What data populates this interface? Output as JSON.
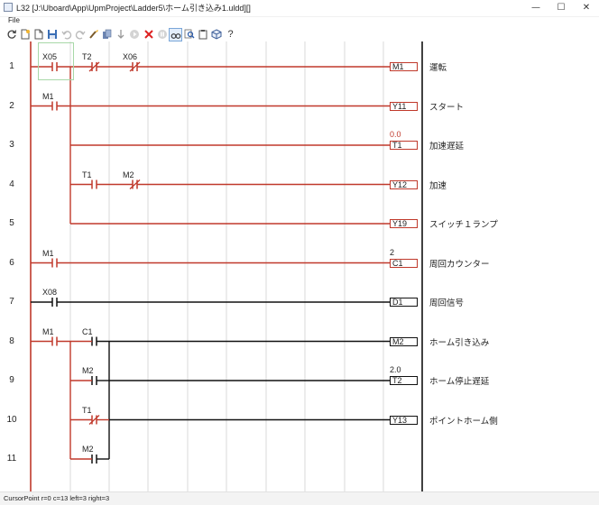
{
  "window": {
    "title": "L32 [J:\\Uboard\\App\\UpmProject\\Ladder5\\ホーム引き込み1.uldd][]",
    "minimize_glyph": "—",
    "maximize_glyph": "☐",
    "close_glyph": "✕"
  },
  "menu": {
    "file": "File"
  },
  "toolbar": {
    "icons": [
      "refresh-icon",
      "new-file-icon",
      "open-file-icon",
      "save-icon",
      "undo-icon",
      "redo-icon",
      "edit-brush-icon",
      "copy-icon",
      "down-arrow-icon",
      "play-icon",
      "stop-icon",
      "pause-icon",
      "glasses-icon",
      "search-icon",
      "clipboard-icon",
      "cube-icon",
      "help-icon"
    ],
    "help_label": "?"
  },
  "ladder": {
    "rows": [
      {
        "num": "1",
        "coil": "M1",
        "coil_value": "",
        "comment": "運転",
        "energized": true
      },
      {
        "num": "2",
        "coil": "Y11",
        "coil_value": "",
        "comment": "スタート",
        "energized": true
      },
      {
        "num": "3",
        "coil": "T1",
        "coil_value": "0.0",
        "comment": "加速遅延",
        "energized": true
      },
      {
        "num": "4",
        "coil": "Y12",
        "coil_value": "",
        "comment": "加速",
        "energized": true
      },
      {
        "num": "5",
        "coil": "Y19",
        "coil_value": "",
        "comment": "スイッチ１ランプ",
        "energized": true
      },
      {
        "num": "6",
        "coil": "C1",
        "coil_value": "2",
        "comment": "周回カウンター",
        "energized": true
      },
      {
        "num": "7",
        "coil": "D1",
        "coil_value": "",
        "comment": "周回信号",
        "energized": false
      },
      {
        "num": "8",
        "coil": "M2",
        "coil_value": "",
        "comment": "ホーム引き込み",
        "energized": false
      },
      {
        "num": "9",
        "coil": "T2",
        "coil_value": "2.0",
        "comment": "ホーム停止遅延",
        "energized": false
      },
      {
        "num": "10",
        "coil": "Y13",
        "coil_value": "",
        "comment": "ポイントホーム側",
        "energized": false
      },
      {
        "num": "11",
        "coil": "",
        "coil_value": "",
        "comment": "",
        "energized": false
      }
    ],
    "contacts": [
      {
        "label": "X05",
        "row": 1,
        "col": 1,
        "type": "NO",
        "energized": true
      },
      {
        "label": "T2",
        "row": 1,
        "col": 2,
        "type": "NC",
        "energized": true
      },
      {
        "label": "X06",
        "row": 1,
        "col": 3,
        "type": "NC",
        "energized": true
      },
      {
        "label": "M1",
        "row": 2,
        "col": 1,
        "type": "NO",
        "energized": true
      },
      {
        "label": "T1",
        "row": 4,
        "col": 2,
        "type": "NO",
        "energized": true
      },
      {
        "label": "M2",
        "row": 4,
        "col": 3,
        "type": "NC",
        "energized": true
      },
      {
        "label": "M1",
        "row": 6,
        "col": 1,
        "type": "NO",
        "energized": true
      },
      {
        "label": "X08",
        "row": 7,
        "col": 1,
        "type": "NO",
        "energized": false
      },
      {
        "label": "M1",
        "row": 8,
        "col": 1,
        "type": "NO",
        "energized": true
      },
      {
        "label": "C1",
        "row": 8,
        "col": 2,
        "type": "NO",
        "energized": false
      },
      {
        "label": "M2",
        "row": 9,
        "col": 2,
        "type": "NO",
        "energized": false
      },
      {
        "label": "T1",
        "row": 10,
        "col": 2,
        "type": "NC",
        "energized": true
      },
      {
        "label": "M2",
        "row": 11,
        "col": 2,
        "type": "NO",
        "energized": false
      }
    ],
    "colors": {
      "energized": "#c0392b",
      "off": "#111111",
      "grid": "#d9d9d9"
    }
  },
  "status": {
    "text": "CursorPoint   r=0 c=13   left=3 right=3"
  }
}
